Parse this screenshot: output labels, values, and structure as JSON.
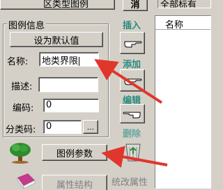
{
  "top_button": {
    "label": "区类型图例"
  },
  "top_right_button": {
    "label": "消"
  },
  "top_right_field": {
    "value": "全部标有"
  },
  "legend_group": {
    "title": "图例信息",
    "set_default_label": "设为默认值",
    "name_label": "名称:",
    "name_value": "地类界限",
    "desc_label": "描述:",
    "desc_value": "",
    "code_label": "编码:",
    "code_value": "0",
    "subcode_label": "分类码:",
    "subcode_value": "0",
    "browse_label": "..."
  },
  "side_actions": {
    "insert_label": "插入",
    "add_label": "添加",
    "edit_label": "编辑",
    "delete_label": "删除"
  },
  "legend_params_label": "图例参数",
  "attr_struct_label": "属性结构",
  "unify_attr_label": "统改属性",
  "list": {
    "header_name": "名称"
  },
  "colors": {
    "accent_teal": "#2a8a7e",
    "arrow_red": "#e0362c"
  }
}
